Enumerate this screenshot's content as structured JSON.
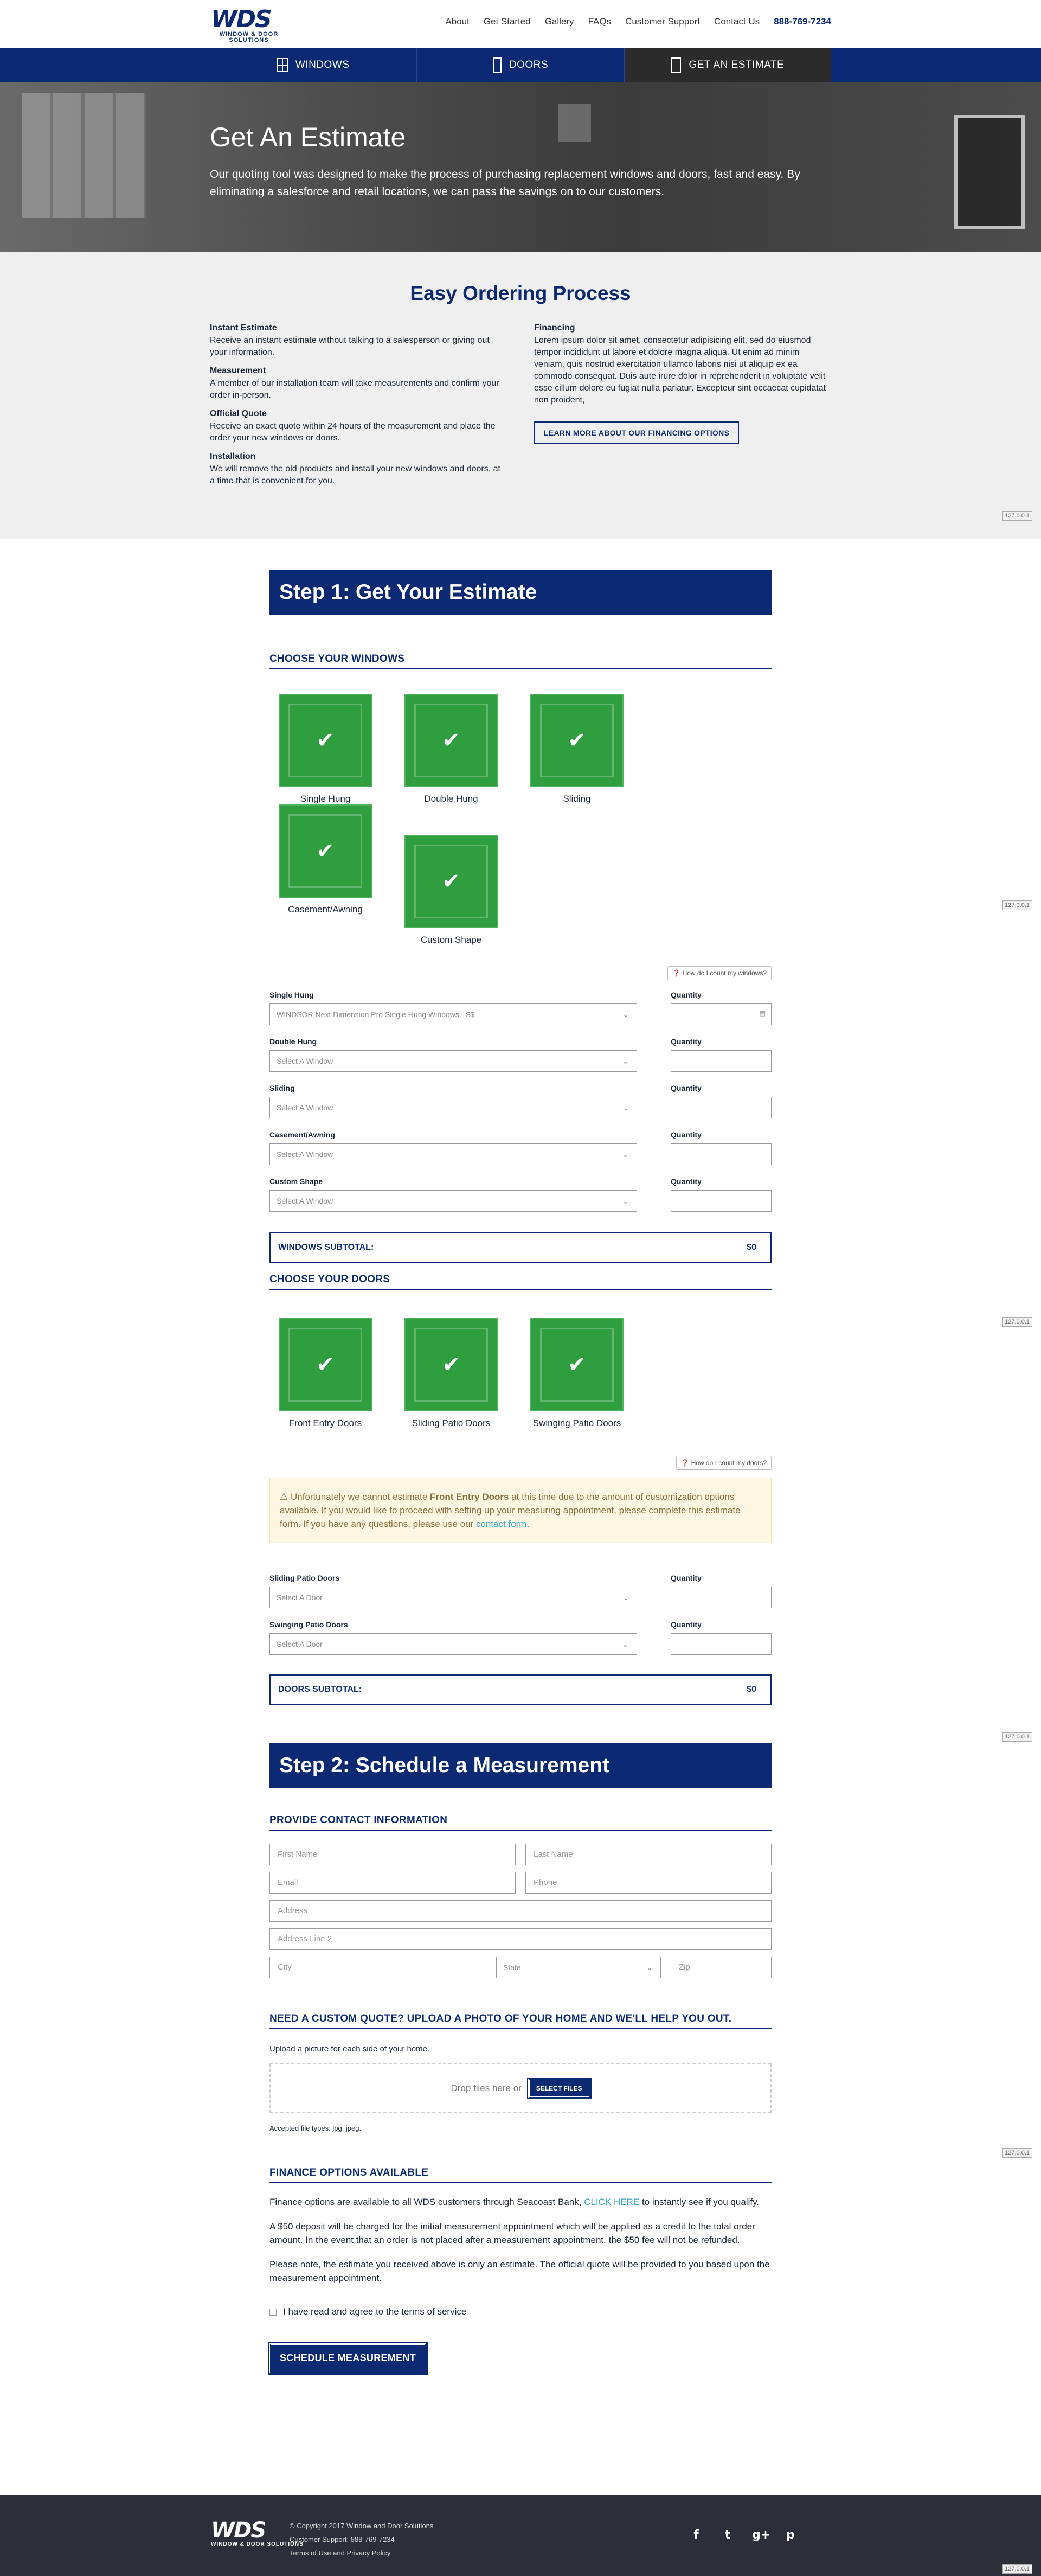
{
  "header": {
    "logo_main": "WDS",
    "logo_sub": "WINDOW & DOOR SOLUTIONS",
    "nav": [
      "About",
      "Get Started",
      "Gallery",
      "FAQs",
      "Customer Support",
      "Contact Us"
    ],
    "phone": "888-769-7234"
  },
  "main_nav": {
    "windows": "WINDOWS",
    "doors": "DOORS",
    "estimate": "GET AN ESTIMATE"
  },
  "hero": {
    "title": "Get An Estimate",
    "text": "Our quoting tool was designed to make the process of purchasing replacement windows and doors, fast and easy. By eliminating a salesforce and retail locations, we can pass the savings on to our customers."
  },
  "process": {
    "title": "Easy Ordering Process",
    "left": [
      {
        "h": "Instant Estimate",
        "t": "Receive an instant estimate without talking to a salesperson or giving out your information."
      },
      {
        "h": "Measurement",
        "t": "A member of our installation team will take measurements and confirm your order in-person."
      },
      {
        "h": "Official Quote",
        "t": "Receive an exact quote within 24 hours of the measurement and place the order your new windows or doors."
      },
      {
        "h": "Installation",
        "t": "We will remove the old products and install your new windows and doors, at a time that is convenient for you."
      }
    ],
    "financing_h": "Financing",
    "financing_t": "Lorem ipsum dolor sit amet, consectetur adipisicing elit, sed do eiusmod tempor incididunt ut labore et dolore magna aliqua. Ut enim ad minim veniam, quis nostrud exercitation ullamco laboris nisi ut aliquip ex ea commodo consequat. Duis aute irure dolor in reprehenderit in voluptate velit esse cillum dolore eu fugiat nulla pariatur. Excepteur sint occaecat cupidatat non proident,",
    "financing_btn": "LEARN MORE ABOUT OUR FINANCING OPTIONS"
  },
  "version": "127.0.0.1",
  "step1": {
    "title": "Step 1: Get Your Estimate",
    "windows_h": "CHOOSE YOUR WINDOWS",
    "window_tiles": [
      "Single Hung",
      "Double Hung",
      "Sliding",
      "Casement/Awning",
      "Custom Shape"
    ],
    "windows_help": "How do I count my windows?",
    "window_rows": [
      {
        "label": "Single Hung",
        "value": "WINDSOR Next Dimension Pro Single Hung Windows - $$"
      },
      {
        "label": "Double Hung",
        "value": "Select A Window"
      },
      {
        "label": "Sliding",
        "value": "Select A Window"
      },
      {
        "label": "Casement/Awning",
        "value": "Select A Window"
      },
      {
        "label": "Custom Shape",
        "value": "Select A Window"
      }
    ],
    "quantity_label": "Quantity",
    "windows_subtotal_label": "WINDOWS SUBTOTAL:",
    "windows_subtotal": "$0",
    "doors_h": "CHOOSE YOUR DOORS",
    "door_tiles": [
      "Front Entry Doors",
      "Sliding Patio Doors",
      "Swinging Patio Doors"
    ],
    "doors_help": "How do I count my doors?",
    "warn_pre": "Unfortunately we cannot estimate ",
    "warn_bold": "Front Entry Doors",
    "warn_post": " at this time due to the amount of customization options available. If you would like to proceed with setting up your measuring appointment, please complete this estimate form. If you have any questions, please use our ",
    "warn_link": "contact form",
    "warn_end": ".",
    "door_rows": [
      {
        "label": "Sliding Patio Doors",
        "value": "Select A Door"
      },
      {
        "label": "Swinging Patio Doors",
        "value": "Select A Door"
      }
    ],
    "doors_subtotal_label": "DOORS SUBTOTAL:",
    "doors_subtotal": "$0"
  },
  "step2": {
    "title": "Step 2: Schedule a Measurement",
    "contact_h": "PROVIDE CONTACT INFORMATION",
    "first_name": "First Name",
    "last_name": "Last Name",
    "email": "Email",
    "phone": "Phone",
    "address": "Address",
    "address2": "Address Line 2",
    "city": "City",
    "state": "State",
    "zip": "Zip",
    "upload_h": "NEED A CUSTOM QUOTE? UPLOAD A PHOTO OF YOUR HOME AND WE'LL HELP YOU OUT.",
    "upload_hint": "Upload a picture for each side of your home.",
    "drop_text": "Drop files here or",
    "select_files": "SELECT FILES",
    "accepted": "Accepted file types: jpg, jpeg.",
    "finance_h": "FINANCE OPTIONS AVAILABLE",
    "finance_p1_pre": "Finance options are available to all WDS customers through Seacoast Bank, ",
    "finance_p1_link": "CLICK HERE",
    "finance_p1_post": " to instantly see if you qualify.",
    "finance_p2": "A $50 deposit will be charged for the initial measurement appointment which will be applied as a credit to the total order amount. In the event that an order is not placed after a measurement appointment, the $50 fee will not be refunded.",
    "finance_p3": "Please note, the estimate you received above is only an estimate. The official quote will be provided to you based upon the measurement appointment.",
    "terms": "I have read and agree to the terms of service",
    "submit": "SCHEDULE MEASUREMENT"
  },
  "footer": {
    "logo_main": "WDS",
    "logo_sub": "WINDOW & DOOR SOLUTIONS",
    "copyright": "© Copyright 2017 Window and Door Solutions",
    "support": "Customer Support: 888-769-7234",
    "terms": "Terms of Use and Privacy Policy",
    "social": [
      "f",
      "t",
      "g+",
      "p"
    ]
  }
}
